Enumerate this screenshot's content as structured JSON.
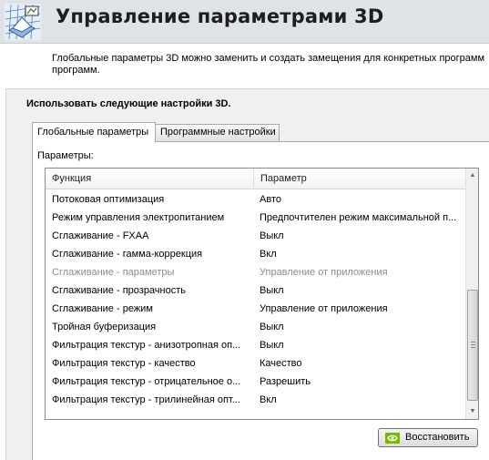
{
  "header": {
    "title": "Управление параметрами 3D",
    "icon": "nvidia-3d-settings-icon"
  },
  "description": {
    "line1": "Глобальные параметры 3D можно заменить и создать замещения для конкретных программ",
    "line2": "программ."
  },
  "panel": {
    "heading": "Использовать следующие настройки 3D."
  },
  "tabs": [
    {
      "label": "Глобальные параметры",
      "active": true
    },
    {
      "label": "Программные настройки",
      "active": false
    }
  ],
  "params_label": "Параметры:",
  "table": {
    "columns": [
      "Функция",
      "Параметр"
    ],
    "rows": [
      {
        "function": "Потоковая оптимизация",
        "value": "Авто",
        "disabled": false
      },
      {
        "function": "Режим управления электропитанием",
        "value": "Предпочтителен режим максимальной п...",
        "disabled": false
      },
      {
        "function": "Сглаживание - FXAA",
        "value": "Выкл",
        "disabled": false
      },
      {
        "function": "Сглаживание - гамма-коррекция",
        "value": "Вкл",
        "disabled": false
      },
      {
        "function": "Сглаживание - параметры",
        "value": "Управление от приложения",
        "disabled": true
      },
      {
        "function": "Сглаживание - прозрачность",
        "value": "Выкл",
        "disabled": false
      },
      {
        "function": "Сглаживание - режим",
        "value": "Управление от приложения",
        "disabled": false
      },
      {
        "function": "Тройная буферизация",
        "value": "Выкл",
        "disabled": false
      },
      {
        "function": "Фильтрация текстур - анизотропная оп...",
        "value": "Выкл",
        "disabled": false
      },
      {
        "function": "Фильтрация текстур - качество",
        "value": "Качество",
        "disabled": false
      },
      {
        "function": "Фильтрация текстур - отрицательное о...",
        "value": "Разрешить",
        "disabled": false
      },
      {
        "function": "Фильтрация текстур - трилинейная опт...",
        "value": "Вкл",
        "disabled": false
      }
    ]
  },
  "restore_button": {
    "label": "Восстановить",
    "icon": "nvidia-logo-icon"
  },
  "colors": {
    "header_bg": "#dfe3e8",
    "panel_bg": "#f0f0f0",
    "disabled_text": "#8c8c8c",
    "nvidia_green": "#76b900"
  }
}
